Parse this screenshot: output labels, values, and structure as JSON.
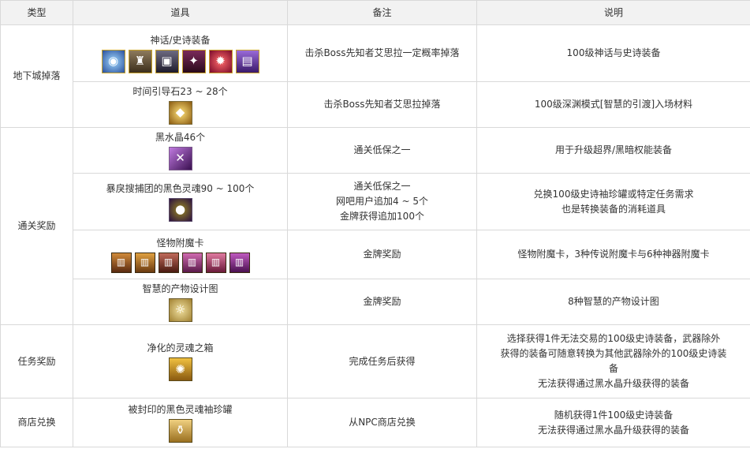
{
  "headers": {
    "type": "类型",
    "item": "道具",
    "note": "备注",
    "desc": "说明"
  },
  "categories": {
    "dungeon": "地下城掉落",
    "clear": "通关奖励",
    "quest": "任务奖励",
    "shop": "商店兑换"
  },
  "rows": [
    {
      "item": "神话/史诗装备",
      "note": "击杀Boss先知者艾思拉一定概率掉落",
      "desc": [
        "100级神话与史诗装备"
      ]
    },
    {
      "item": "时间引导石23 ~ 28个",
      "note": "击杀Boss先知者艾思拉掉落",
      "desc": [
        "100级深渊模式[智慧的引渡]入场材料"
      ]
    },
    {
      "item": "黑水晶46个",
      "note": "通关低保之一",
      "desc": [
        "用于升级超界/黑暗权能装备"
      ]
    },
    {
      "item": "暴戾搜捕团的黑色灵魂90 ~ 100个",
      "note": [
        "通关低保之一",
        "网吧用户追加4 ~ 5个",
        "金牌获得追加100个"
      ],
      "desc": [
        "兑换100级史诗袖珍罐或特定任务需求",
        "也是转换装备的消耗道具"
      ]
    },
    {
      "item": "怪物附魔卡",
      "note": "金牌奖励",
      "desc": [
        "怪物附魔卡，3种传说附魔卡与6种神器附魔卡"
      ]
    },
    {
      "item": "智慧的产物设计图",
      "note": "金牌奖励",
      "desc": [
        "8种智慧的产物设计图"
      ]
    },
    {
      "item": "净化的灵魂之箱",
      "note": "完成任务后获得",
      "desc": [
        "选择获得1件无法交易的100级史诗装备，武器除外",
        "获得的装备可随意转换为其他武器除外的100级史诗装",
        "备",
        "无法获得通过黑水晶升级获得的装备"
      ]
    },
    {
      "item": "被封印的黑色灵魂袖珍罐",
      "note": "从NPC商店兑换",
      "desc": [
        "随机获得1件100级史诗装备",
        "无法获得通过黑水晶升级获得的装备"
      ]
    }
  ],
  "icons": {
    "row0": [
      "orb-icon",
      "helmet-icon",
      "armor-icon",
      "demon-icon",
      "flame-icon",
      "chest-icon"
    ],
    "row1": [
      "egg-stone-icon"
    ],
    "row2": [
      "crystal-icon"
    ],
    "row3": [
      "dark-soul-icon"
    ],
    "row4": [
      "card-icon",
      "card-icon",
      "card-icon",
      "card-icon",
      "card-icon",
      "card-icon"
    ],
    "row5": [
      "blueprint-icon"
    ],
    "row6": [
      "soul-box-icon"
    ],
    "row7": [
      "sealed-jar-icon"
    ]
  },
  "colors": {
    "header_bg": "#f2f2f2",
    "border": "#d9d9d9",
    "text": "#333333"
  }
}
